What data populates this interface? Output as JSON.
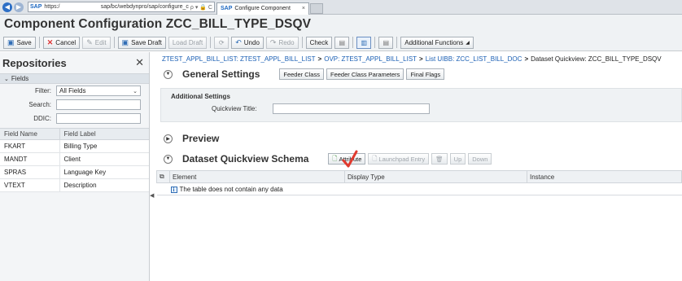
{
  "browser": {
    "url_start": "https:/",
    "url_end": "sap/bc/webdynpro/sap/configure_c",
    "url_controls": "ρ ▾ 🔒 C",
    "tab_title": "Configure Component",
    "tab_close": "×"
  },
  "page": {
    "title": "Component Configuration ZCC_BILL_TYPE_DSQV"
  },
  "toolbar": {
    "save": "Save",
    "cancel": "Cancel",
    "edit": "Edit",
    "save_draft": "Save Draft",
    "load_draft": "Load Draft",
    "undo": "Undo",
    "redo": "Redo",
    "check": "Check",
    "additional_functions": "Additional Functions"
  },
  "repositories": {
    "title": "Repositories",
    "close": "✕",
    "fields_label": "Fields",
    "filter_label": "Filter:",
    "filter_value": "All Fields",
    "search_label": "Search:",
    "ddic_label": "DDIC:",
    "columns": [
      "Field Name",
      "Field Label"
    ],
    "rows": [
      [
        "FKART",
        "Billing Type"
      ],
      [
        "MANDT",
        "Client"
      ],
      [
        "SPRAS",
        "Language Key"
      ],
      [
        "VTEXT",
        "Description"
      ]
    ]
  },
  "breadcrumb": {
    "item1": "ZTEST_APPL_BILL_LIST: ZTEST_APPL_BILL_LIST",
    "item2": "OVP: ZTEST_APPL_BILL_LIST",
    "item3": "List UIBB: ZCC_LIST_BILL_DOC",
    "current": "Dataset Quickview: ZCC_BILL_TYPE_DSQV",
    "separator": ">"
  },
  "general_settings": {
    "title": "General Settings",
    "buttons": [
      "Feeder Class",
      "Feeder Class Parameters",
      "Final Flags"
    ],
    "additional_settings_title": "Additional Settings",
    "quickview_title_label": "Quickview Title:",
    "quickview_title_value": ""
  },
  "preview": {
    "title": "Preview"
  },
  "schema": {
    "title": "Dataset Quickview Schema",
    "attribute_btn": "Attribute",
    "launchpad_btn": "Launchpad Entry",
    "up_btn": "Up",
    "down_btn": "Down",
    "columns": [
      "Element",
      "Display Type",
      "Instance"
    ],
    "empty_message": "The table does not contain any data"
  },
  "colors": {
    "link": "#1a5fb4",
    "annotation_check": "#e03a2e"
  }
}
